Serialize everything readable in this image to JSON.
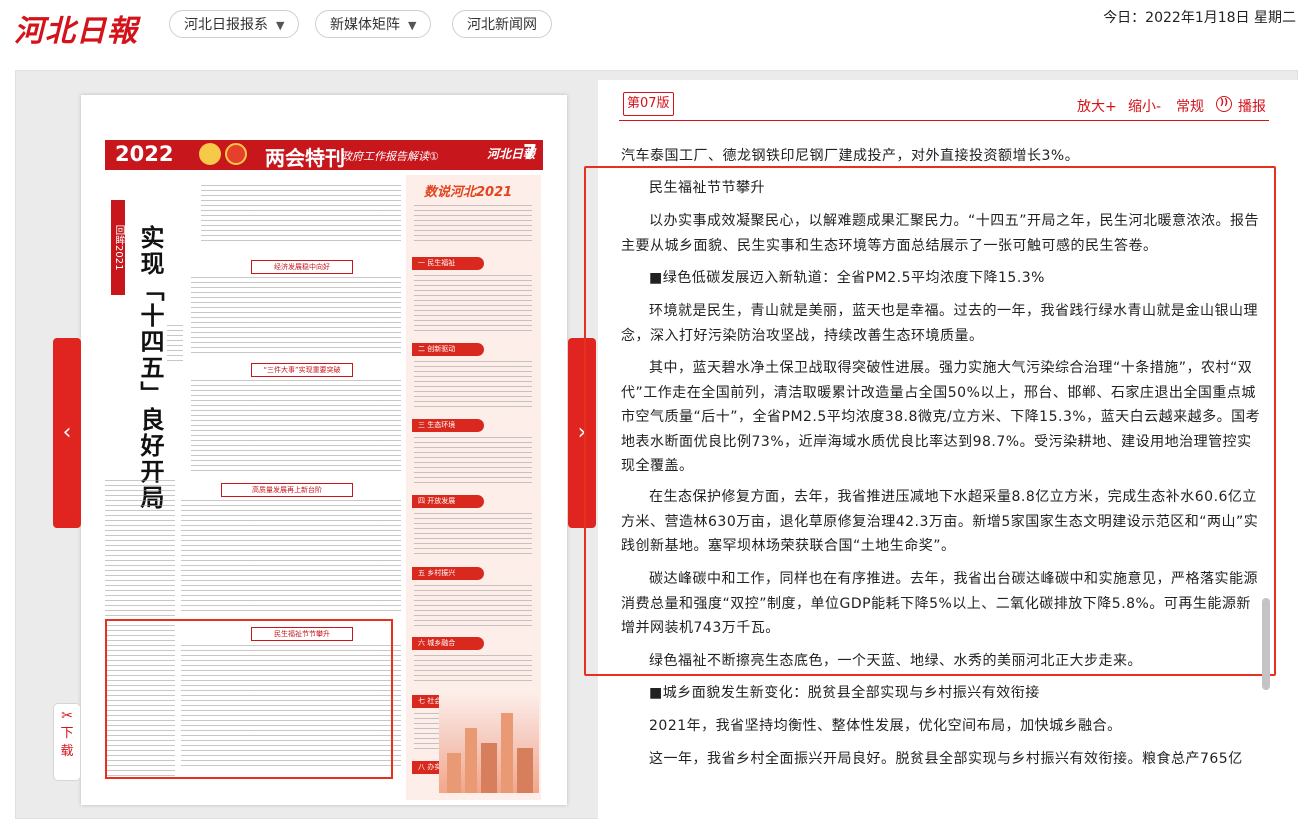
{
  "header": {
    "logo_text": "河北日報",
    "nav": [
      "河北日报报系",
      "新媒体矩阵",
      "河北新闻网"
    ],
    "date_text": "今日：2022年1月18日 星期二"
  },
  "newspaper": {
    "banner_year": "2022",
    "banner_title": "两会特刊",
    "banner_subtitle": "政府工作报告解读①",
    "masthead": "河北日報",
    "page_number": "7",
    "side_label": "回眸2021",
    "headline": "实现「十四五」良好开局",
    "section_headers": [
      "经济发展稳中向好",
      "“三件大事”实现重要突破",
      "高质量发展再上新台阶",
      "民生福祉节节攀升"
    ],
    "info_title": "数说河北2021",
    "categories": [
      "一 民生福祉",
      "二 创新驱动",
      "三 生态环境",
      "四 开放发展",
      "五 乡村振兴",
      "六 城乡融合",
      "七 社会事业",
      "八 办实事"
    ]
  },
  "nav_tabs": {
    "prev": "‹",
    "next": "›",
    "download": [
      "下",
      "载"
    ]
  },
  "article": {
    "edition": "第07版",
    "tools": [
      "放大+",
      "缩小-",
      "常规",
      "播报"
    ],
    "paragraphs": [
      "汽车泰国工厂、德龙钢铁印尼钢厂建成投产，对外直接投资额增长3%。",
      "民生福祉节节攀升",
      "以办实事成效凝聚民心，以解难题成果汇聚民力。“十四五”开局之年，民生河北暖意浓浓。报告主要从城乡面貌、民生实事和生态环境等方面总结展示了一张可触可感的民生答卷。",
      "■绿色低碳发展迈入新轨道：全省PM2.5平均浓度下降15.3%",
      "环境就是民生，青山就是美丽，蓝天也是幸福。过去的一年，我省践行绿水青山就是金山银山理念，深入打好污染防治攻坚战，持续改善生态环境质量。",
      "其中，蓝天碧水净土保卫战取得突破性进展。强力实施大气污染综合治理“十条措施”，农村“双代”工作走在全国前列，清洁取暖累计改造量占全国50%以上，邢台、邯郸、石家庄退出全国重点城市空气质量“后十”，全省PM2.5平均浓度38.8微克/立方米、下降15.3%，蓝天白云越来越多。国考地表水断面优良比例73%，近岸海域水质优良比率达到98.7%。受污染耕地、建设用地治理管控实现全覆盖。",
      "在生态保护修复方面，去年，我省推进压减地下水超采量8.8亿立方米，完成生态补水60.6亿立方米、营造林630万亩，退化草原修复治理42.3万亩。新增5家国家生态文明建设示范区和“两山”实践创新基地。塞罕坝林场荣获联合国“土地生命奖”。",
      "碳达峰碳中和工作，同样也在有序推进。去年，我省出台碳达峰碳中和实施意见，严格落实能源消费总量和强度“双控”制度，单位GDP能耗下降5%以上、二氧化碳排放下降5.8%。可再生能源新增并网装机743万千瓦。",
      "绿色福祉不断擦亮生态底色，一个天蓝、地绿、水秀的美丽河北正大步走来。",
      "■城乡面貌发生新变化：脱贫县全部实现与乡村振兴有效衔接",
      "2021年，我省坚持均衡性、整体性发展，优化空间布局，加快城乡融合。",
      "这一年，我省乡村全面振兴开局良好。脱贫县全部实现与乡村振兴有效衔接。粮食总产765亿"
    ]
  },
  "colors": {
    "brand_red": "#d3121a",
    "highlight_red": "#e8301e"
  }
}
